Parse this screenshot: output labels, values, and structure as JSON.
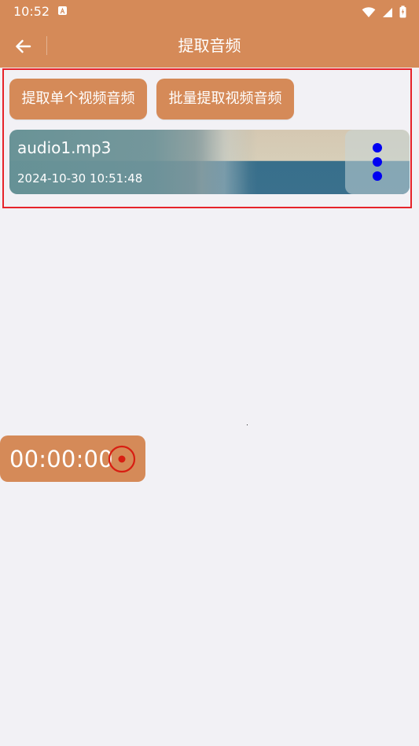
{
  "status_bar": {
    "time": "10:52"
  },
  "header": {
    "title": "提取音频"
  },
  "actions": {
    "single_label": "提取单个视频音频",
    "batch_label": "批量提取视频音频"
  },
  "file_item": {
    "name": "audio1.mp3",
    "date": "2024-10-30 10:51:48"
  },
  "recorder": {
    "timer": "00:00:00"
  },
  "colors": {
    "brand": "#d58a58",
    "background": "#f2f1f5",
    "highlight": "#e6232a",
    "dot": "#0000f2",
    "record": "#d81e12"
  },
  "icons": {
    "back": "arrow-left-icon",
    "more": "more-vertical-icon",
    "record": "record-icon"
  }
}
